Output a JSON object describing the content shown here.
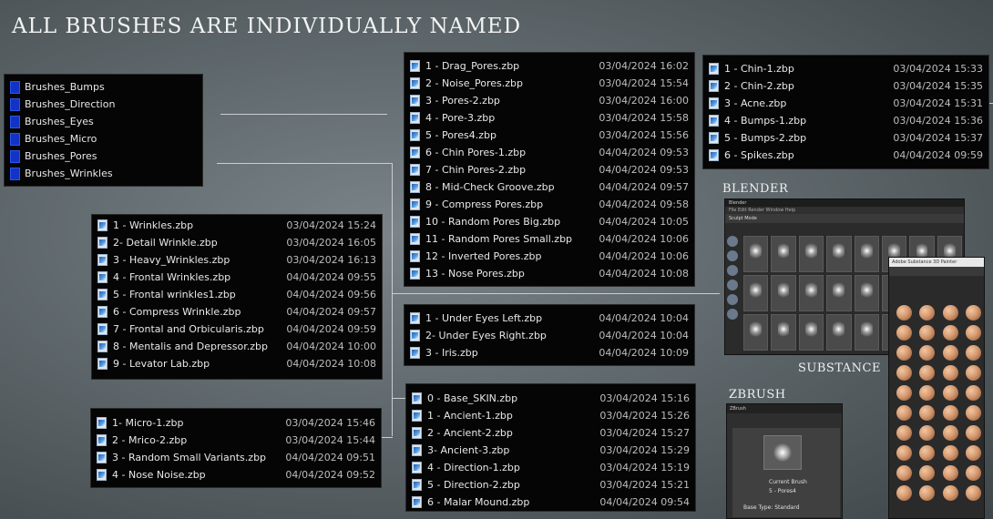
{
  "heading": "ALL BRUSHES ARE INDIVIDUALLY NAMED",
  "labels": {
    "blender": "BLENDER",
    "substance": "SUBSTANCE",
    "zbrush": "ZBRUSH"
  },
  "folders": [
    "Brushes_Bumps",
    "Brushes_Direction",
    "Brushes_Eyes",
    "Brushes_Micro",
    "Brushes_Pores",
    "Brushes_Wrinkles"
  ],
  "wrinkles": [
    {
      "name": "1 - Wrinkles.zbp",
      "date": "03/04/2024 15:24"
    },
    {
      "name": "2- Detail Wrinkle.zbp",
      "date": "03/04/2024 16:05"
    },
    {
      "name": "3 - Heavy_Wrinkles.zbp",
      "date": "03/04/2024 16:13"
    },
    {
      "name": "4 - Frontal Wrinkles.zbp",
      "date": "04/04/2024 09:55"
    },
    {
      "name": "5 - Frontal wrinkles1.zbp",
      "date": "04/04/2024 09:56"
    },
    {
      "name": "6 - Compress Wrinkle.zbp",
      "date": "04/04/2024 09:57"
    },
    {
      "name": "7 - Frontal and Orbicularis.zbp",
      "date": "04/04/2024 09:59"
    },
    {
      "name": "8 - Mentalis and Depressor.zbp",
      "date": "04/04/2024 10:00"
    },
    {
      "name": "9 - Levator Lab.zbp",
      "date": "04/04/2024 10:08"
    }
  ],
  "micro": [
    {
      "name": "1- Micro-1.zbp",
      "date": "03/04/2024 15:46"
    },
    {
      "name": "2 - Mrico-2.zbp",
      "date": "03/04/2024 15:44"
    },
    {
      "name": "3 - Random Small Variants.zbp",
      "date": "04/04/2024 09:51"
    },
    {
      "name": "4 -  Nose Noise.zbp",
      "date": "04/04/2024 09:52"
    }
  ],
  "pores": [
    {
      "name": "1 - Drag_Pores.zbp",
      "date": "03/04/2024 16:02"
    },
    {
      "name": "2 - Noise_Pores.zbp",
      "date": "03/04/2024 15:54"
    },
    {
      "name": "3 - Pores-2.zbp",
      "date": "03/04/2024 16:00"
    },
    {
      "name": "4 - Pore-3.zbp",
      "date": "03/04/2024 15:58"
    },
    {
      "name": "5 - Pores4.zbp",
      "date": "03/04/2024 15:56"
    },
    {
      "name": "6 - Chin Pores-1.zbp",
      "date": "04/04/2024 09:53"
    },
    {
      "name": "7 - Chin Pores-2.zbp",
      "date": "04/04/2024 09:53"
    },
    {
      "name": "8 -  Mid-Check Groove.zbp",
      "date": "04/04/2024 09:57"
    },
    {
      "name": "9 -  Compress Pores.zbp",
      "date": "04/04/2024 09:58"
    },
    {
      "name": "10 - Random Pores Big.zbp",
      "date": "04/04/2024 10:05"
    },
    {
      "name": "11 - Random Pores Small.zbp",
      "date": "04/04/2024 10:06"
    },
    {
      "name": "12 - Inverted Pores.zbp",
      "date": "04/04/2024 10:06"
    },
    {
      "name": "13 - Nose Pores.zbp",
      "date": "04/04/2024 10:08"
    }
  ],
  "eyes": [
    {
      "name": "1 - Under Eyes Left.zbp",
      "date": "04/04/2024 10:04"
    },
    {
      "name": "2-  Under Eyes Right.zbp",
      "date": "04/04/2024 10:04"
    },
    {
      "name": "3 -  Iris.zbp",
      "date": "04/04/2024 10:09"
    }
  ],
  "direction": [
    {
      "name": "0 - Base_SKIN.zbp",
      "date": "03/04/2024 15:16"
    },
    {
      "name": "1 - Ancient-1.zbp",
      "date": "03/04/2024 15:26"
    },
    {
      "name": "2 - Ancient-2.zbp",
      "date": "03/04/2024 15:27"
    },
    {
      "name": "3- Ancient-3.zbp",
      "date": "03/04/2024 15:29"
    },
    {
      "name": "4 - Direction-1.zbp",
      "date": "03/04/2024 15:19"
    },
    {
      "name": "5 - Direction-2.zbp",
      "date": "03/04/2024 15:21"
    },
    {
      "name": "6 -  Malar Mound.zbp",
      "date": "04/04/2024 09:54"
    }
  ],
  "bumps": [
    {
      "name": "1 - Chin-1.zbp",
      "date": "03/04/2024 15:33"
    },
    {
      "name": "2 - Chin-2.zbp",
      "date": "03/04/2024 15:35"
    },
    {
      "name": "3 - Acne.zbp",
      "date": "03/04/2024 15:31"
    },
    {
      "name": "4 - Bumps-1.zbp",
      "date": "03/04/2024 15:36"
    },
    {
      "name": "5 - Bumps-2.zbp",
      "date": "03/04/2024 15:37"
    },
    {
      "name": "6 - Spikes.zbp",
      "date": "04/04/2024 09:59"
    }
  ],
  "zbrush_panel": {
    "title": "Current Brush",
    "brush": "5 - Pores4",
    "base": "Base Type: Standard"
  },
  "blender_panel": {
    "title": "Blender",
    "menu": "File  Edit  Render  Window  Help",
    "mode": "Sculpt Mode"
  },
  "substance_panel": {
    "title": "Adobe Substance 3D Painter"
  }
}
